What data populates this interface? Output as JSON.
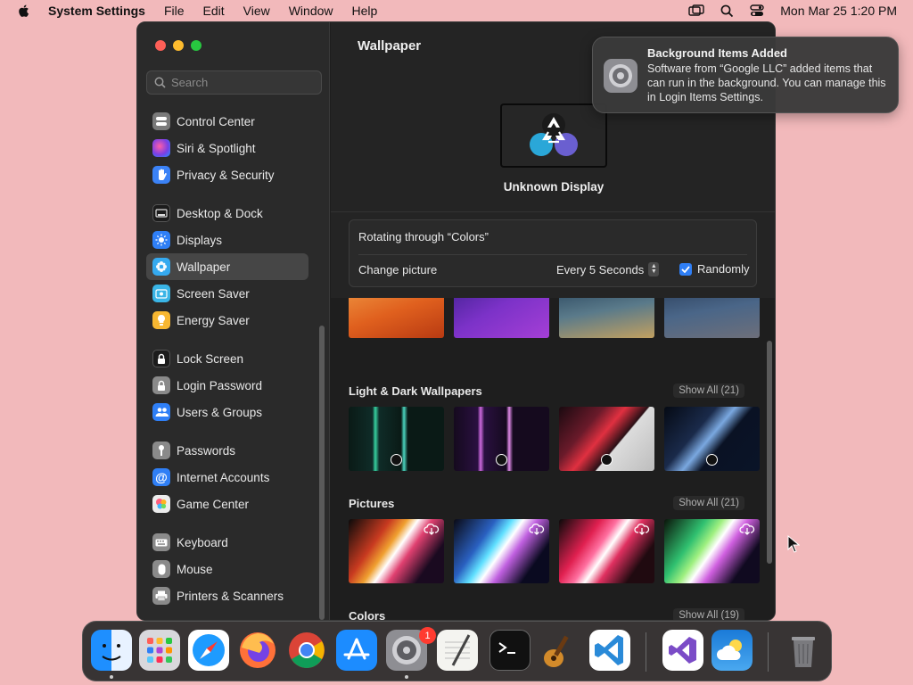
{
  "menubar": {
    "app_name": "System Settings",
    "menus": [
      "File",
      "Edit",
      "View",
      "Window",
      "Help"
    ],
    "datetime": "Mon Mar 25  1:20 PM"
  },
  "sidebar": {
    "search_placeholder": "Search",
    "groups": [
      [
        {
          "label": "Control Center",
          "icon": "control-center-icon",
          "color": "#7a7a7a"
        },
        {
          "label": "Siri & Spotlight",
          "icon": "siri-icon",
          "color": "#b042d6"
        },
        {
          "label": "Privacy & Security",
          "icon": "hand-icon",
          "color": "#3b82f6"
        }
      ],
      [
        {
          "label": "Desktop & Dock",
          "icon": "dock-icon",
          "color": "#1c1c1c"
        },
        {
          "label": "Displays",
          "icon": "sun-icon",
          "color": "#2f7ff6"
        },
        {
          "label": "Wallpaper",
          "icon": "wallpaper-icon",
          "color": "#35aaf0",
          "selected": true
        },
        {
          "label": "Screen Saver",
          "icon": "screen-saver-icon",
          "color": "#3ab5e6"
        },
        {
          "label": "Energy Saver",
          "icon": "lightbulb-icon",
          "color": "#f7b731"
        }
      ],
      [
        {
          "label": "Lock Screen",
          "icon": "lock-icon",
          "color": "#1c1c1c"
        },
        {
          "label": "Login Password",
          "icon": "padlock-icon",
          "color": "#8a8a8a"
        },
        {
          "label": "Users & Groups",
          "icon": "users-icon",
          "color": "#2f7ff6"
        }
      ],
      [
        {
          "label": "Passwords",
          "icon": "key-icon",
          "color": "#8a8a8a"
        },
        {
          "label": "Internet Accounts",
          "icon": "at-icon",
          "color": "#2f7ff6"
        },
        {
          "label": "Game Center",
          "icon": "game-center-icon",
          "color": "#ececec"
        }
      ],
      [
        {
          "label": "Keyboard",
          "icon": "keyboard-icon",
          "color": "#8a8a8a"
        },
        {
          "label": "Mouse",
          "icon": "mouse-icon",
          "color": "#8a8a8a"
        },
        {
          "label": "Printers & Scanners",
          "icon": "printer-icon",
          "color": "#8a8a8a"
        }
      ]
    ]
  },
  "content": {
    "title": "Wallpaper",
    "display_label": "Unknown Display",
    "rotating": "Rotating through “Colors”",
    "change_picture": "Change picture",
    "interval": "Every 5 Seconds",
    "randomly": "Randomly",
    "sections": [
      {
        "title": "Light & Dark Wallpapers",
        "show_all": "Show All (21)"
      },
      {
        "title": "Pictures",
        "show_all": "Show All (21)"
      },
      {
        "title": "Colors",
        "show_all": "Show All (19)"
      }
    ]
  },
  "notification": {
    "title": "Background Items Added",
    "body": "Software from “Google LLC” added items that can run in the background. You can manage this in Login Items Settings."
  },
  "dock": {
    "settings_badge": "1",
    "apps": [
      "Finder",
      "Launchpad",
      "Safari",
      "Firefox",
      "Chrome",
      "App Store",
      "System Settings",
      "TextEdit",
      "Terminal",
      "GarageBand",
      "VS Code",
      "Visual Studio",
      "Weather",
      "Trash"
    ]
  },
  "colors": {
    "accent": "#2f7ff6",
    "badge": "#ff3b30"
  }
}
